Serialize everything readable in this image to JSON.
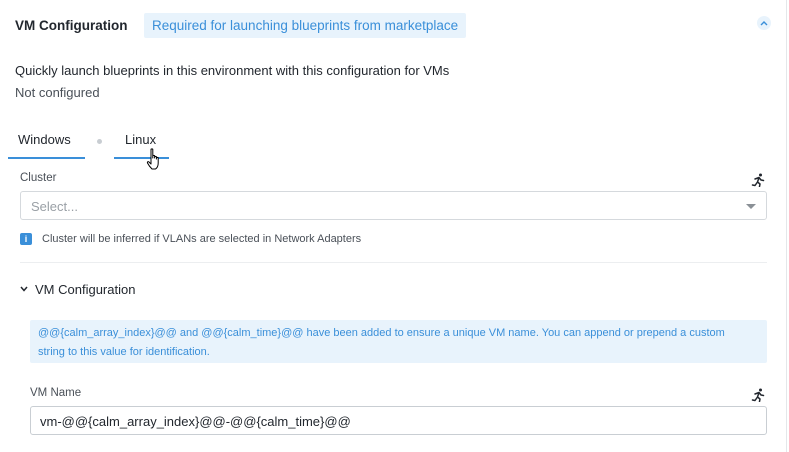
{
  "header": {
    "title": "VM Configuration",
    "badge": "Required for launching blueprints from marketplace"
  },
  "description": "Quickly launch blueprints in this environment with this configuration for VMs",
  "status": "Not configured",
  "tabs": [
    {
      "label": "Windows"
    },
    {
      "label": "Linux"
    }
  ],
  "cluster": {
    "label": "Cluster",
    "placeholder": "Select...",
    "info": "Cluster will be inferred if VLANs are selected in Network Adapters"
  },
  "vm_section": {
    "title": "VM Configuration",
    "notice_line1": "@@{calm_array_index}@@ and @@{calm_time}@@ have been added to ensure a unique VM name. You can append or prepend a custom",
    "notice_line2": "string to this value for identification.",
    "vm_name_label": "VM Name",
    "vm_name_value": "vm-@@{calm_array_index}@@-@@{calm_time}@@"
  },
  "colors": {
    "accent": "#3a8fd9",
    "badge_bg": "#e8f3fc"
  }
}
